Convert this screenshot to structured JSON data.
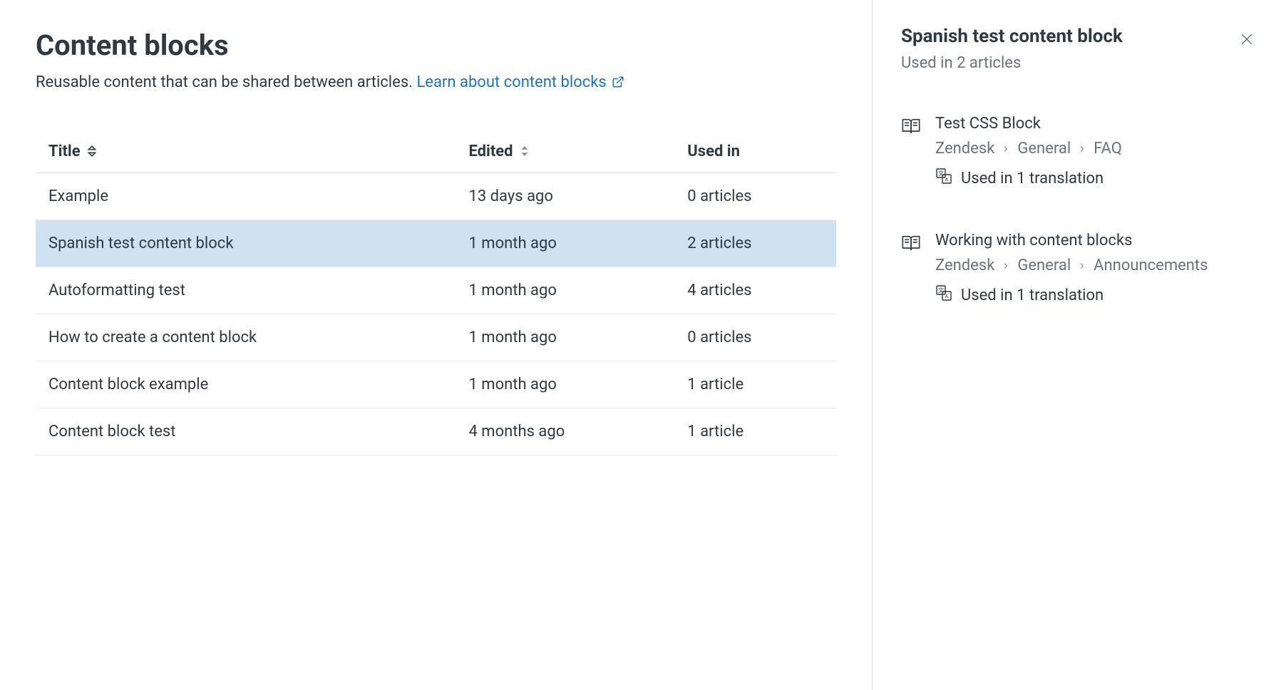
{
  "header": {
    "title": "Content blocks",
    "subtitle_prefix": "Reusable content that can be shared between articles. ",
    "learn_link": "Learn about content blocks"
  },
  "table": {
    "columns": {
      "title": "Title",
      "edited": "Edited",
      "used_in": "Used in"
    },
    "rows": [
      {
        "title": "Example",
        "edited": "13 days ago",
        "used_in": "0 articles",
        "selected": false
      },
      {
        "title": "Spanish test content block",
        "edited": "1 month ago",
        "used_in": "2 articles",
        "selected": true
      },
      {
        "title": "Autoformatting test",
        "edited": "1 month ago",
        "used_in": "4 articles",
        "selected": false
      },
      {
        "title": "How to create a content block",
        "edited": "1 month ago",
        "used_in": "0 articles",
        "selected": false
      },
      {
        "title": "Content block example",
        "edited": "1 month ago",
        "used_in": "1 article",
        "selected": false
      },
      {
        "title": "Content block test",
        "edited": "4 months ago",
        "used_in": "1 article",
        "selected": false
      }
    ]
  },
  "panel": {
    "title": "Spanish test content block",
    "subtitle": "Used in 2 articles",
    "articles": [
      {
        "title": "Test CSS Block",
        "breadcrumb": [
          "Zendesk",
          "General",
          "FAQ"
        ],
        "translation": "Used in 1 translation"
      },
      {
        "title": "Working with content blocks",
        "breadcrumb": [
          "Zendesk",
          "General",
          "Announcements"
        ],
        "translation": "Used in 1 translation"
      }
    ]
  }
}
